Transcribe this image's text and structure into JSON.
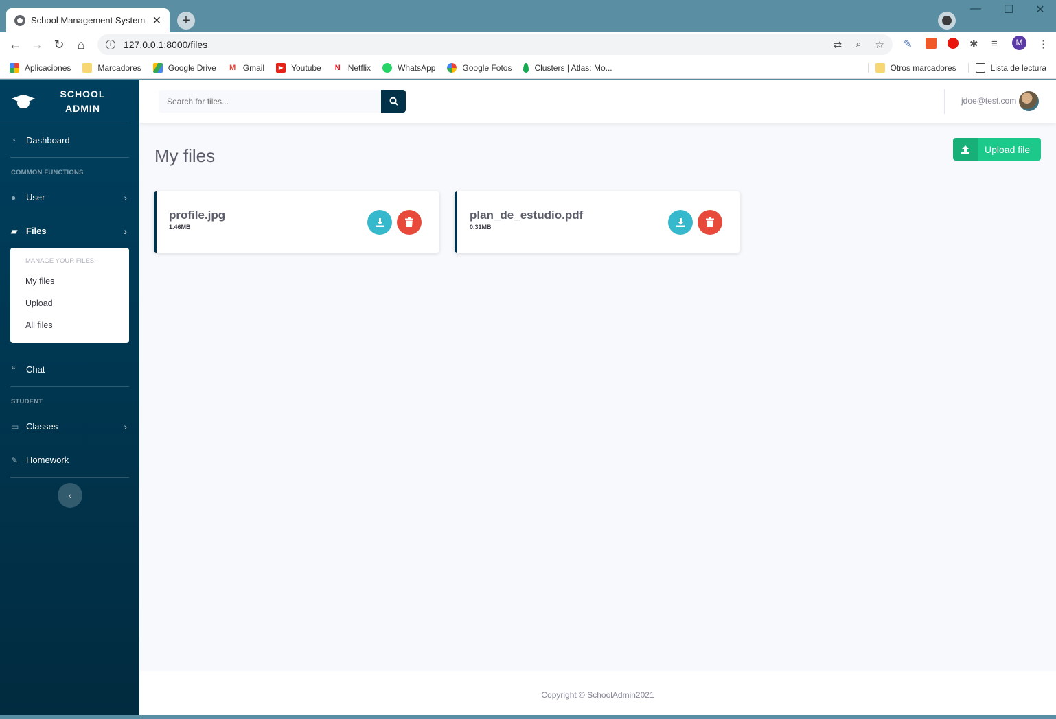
{
  "browser": {
    "tab_title": "School Management System",
    "url": "127.0.0.1:8000/files",
    "profile_initial": "M",
    "bookmarks": [
      "Aplicaciones",
      "Marcadores",
      "Google Drive",
      "Gmail",
      "Youtube",
      "Netflix",
      "WhatsApp",
      "Google Fotos",
      "Clusters | Atlas: Mo..."
    ],
    "bookmarks_right": [
      "Otros marcadores",
      "Lista de lectura"
    ]
  },
  "sidebar": {
    "brand": "SCHOOL ADMIN",
    "dashboard": "Dashboard",
    "heading_common": "COMMON FUNCTIONS",
    "user": "User",
    "files": "Files",
    "submenu_heading": "MANAGE YOUR FILES:",
    "submenu_items": [
      "My files",
      "Upload",
      "All files"
    ],
    "chat": "Chat",
    "heading_student": "STUDENT",
    "classes": "Classes",
    "homework": "Homework"
  },
  "topbar": {
    "search_placeholder": "Search for files...",
    "user_email": "jdoe@test.com"
  },
  "main": {
    "title": "My files",
    "upload_button": "Upload file",
    "files": [
      {
        "name": "profile.jpg",
        "size": "1.46MB"
      },
      {
        "name": "plan_de_estudio.pdf",
        "size": "0.31MB"
      }
    ]
  },
  "footer": {
    "copyright": "Copyright © SchoolAdmin2021"
  },
  "colors": {
    "sidebar": "#00405f",
    "primary_dark": "#01324a",
    "download": "#36b9cc",
    "delete": "#e74a3b",
    "upload": "#1cc88a"
  }
}
